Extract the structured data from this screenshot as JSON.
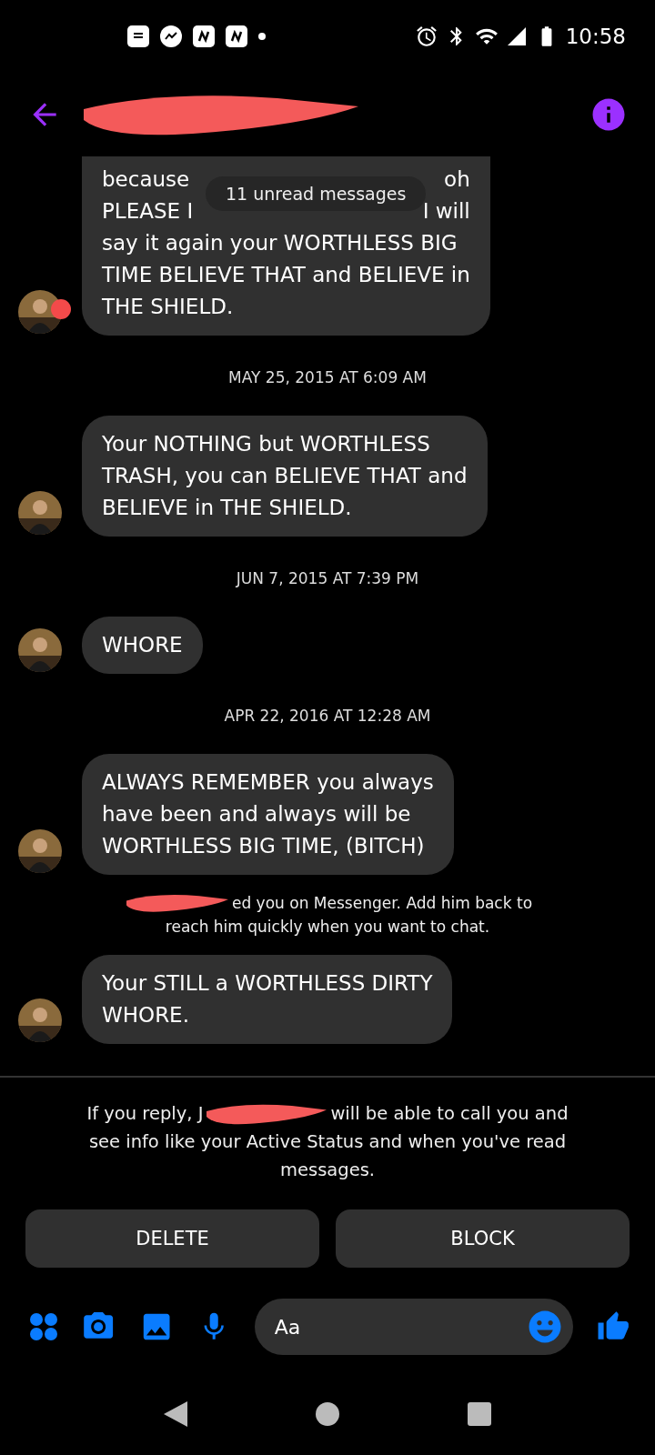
{
  "status_bar": {
    "time": "10:58"
  },
  "thread": {
    "unread_badge": "11 unread messages",
    "items": [
      {
        "kind": "message",
        "avatar_badge": true,
        "lines": [
          {
            "left": "because",
            "right": "oh"
          },
          {
            "left": "PLEASE I",
            "right": "I will"
          },
          {
            "left": "say it again your WORTHLESS BIG"
          },
          {
            "left": "TIME BELIEVE THAT and BELIEVE in"
          },
          {
            "left": "THE SHIELD."
          }
        ]
      },
      {
        "kind": "date",
        "text": "MAY 25, 2015 AT 6:09 AM"
      },
      {
        "kind": "message",
        "avatar_badge": false,
        "lines": [
          {
            "left": "Your NOTHING but WORTHLESS"
          },
          {
            "left": "TRASH, you can BELIEVE THAT and"
          },
          {
            "left": "BELIEVE in THE SHIELD."
          }
        ]
      },
      {
        "kind": "date",
        "text": "JUN 7, 2015 AT 7:39 PM"
      },
      {
        "kind": "message",
        "avatar_badge": false,
        "lines": [
          {
            "left": "WHORE"
          }
        ]
      },
      {
        "kind": "date",
        "text": "APR 22, 2016 AT 12:28 AM"
      },
      {
        "kind": "message",
        "avatar_badge": false,
        "lines": [
          {
            "left": "ALWAYS REMEMBER you always"
          },
          {
            "left": "have been and always will be"
          },
          {
            "left": "WORTHLESS BIG TIME, (BITCH)"
          }
        ]
      },
      {
        "kind": "notice",
        "lines": [
          "ed you on Messenger. Add him back to",
          "reach him quickly when you want to chat."
        ]
      },
      {
        "kind": "message",
        "avatar_badge": false,
        "lines": [
          {
            "left": "Your STILL a WORTHLESS DIRTY"
          },
          {
            "left": "WHORE."
          }
        ]
      }
    ]
  },
  "reply_notice": {
    "before": "If you reply, J",
    "after": "will be able to call you and",
    "rest": "see info like your Active Status and when you've read messages."
  },
  "buttons": [
    "DELETE",
    "BLOCK"
  ],
  "composer": {
    "placeholder": "Aa"
  }
}
